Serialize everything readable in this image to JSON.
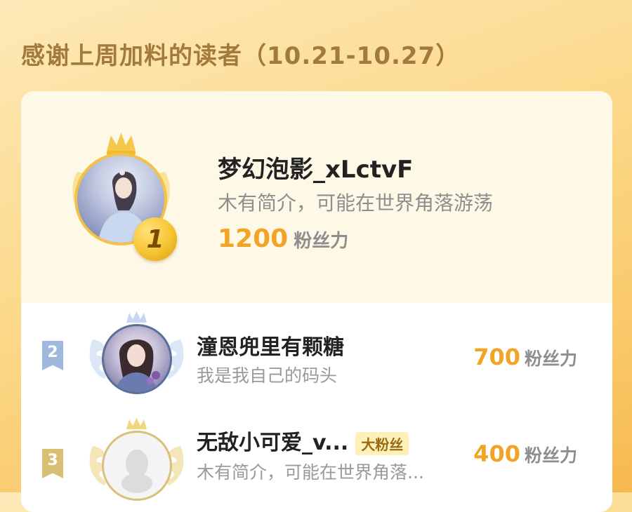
{
  "header": {
    "title": "感谢上周加料的读者（10.21-10.27）"
  },
  "leaderboard": {
    "score_unit": "粉丝力",
    "entries": [
      {
        "rank": "1",
        "name": "梦幻泡影_xLctvF",
        "bio": "木有简介，可能在世界角落游荡",
        "score": "1200",
        "avatar": "illustrated-avatar",
        "tag": ""
      },
      {
        "rank": "2",
        "name": "潼恩兜里有颗糖",
        "bio": "我是我自己的码头",
        "score": "700",
        "avatar": "illustrated-avatar",
        "tag": ""
      },
      {
        "rank": "3",
        "name": "无敌小可爱_v...",
        "bio": "木有简介，可能在世界角落...",
        "score": "400",
        "avatar": "default-avatar",
        "tag": "大粉丝"
      }
    ]
  },
  "colors": {
    "gold": "#f3c247",
    "silver": "#9fb8dd",
    "bronze": "#d9bf74",
    "score": "#f2a426"
  }
}
